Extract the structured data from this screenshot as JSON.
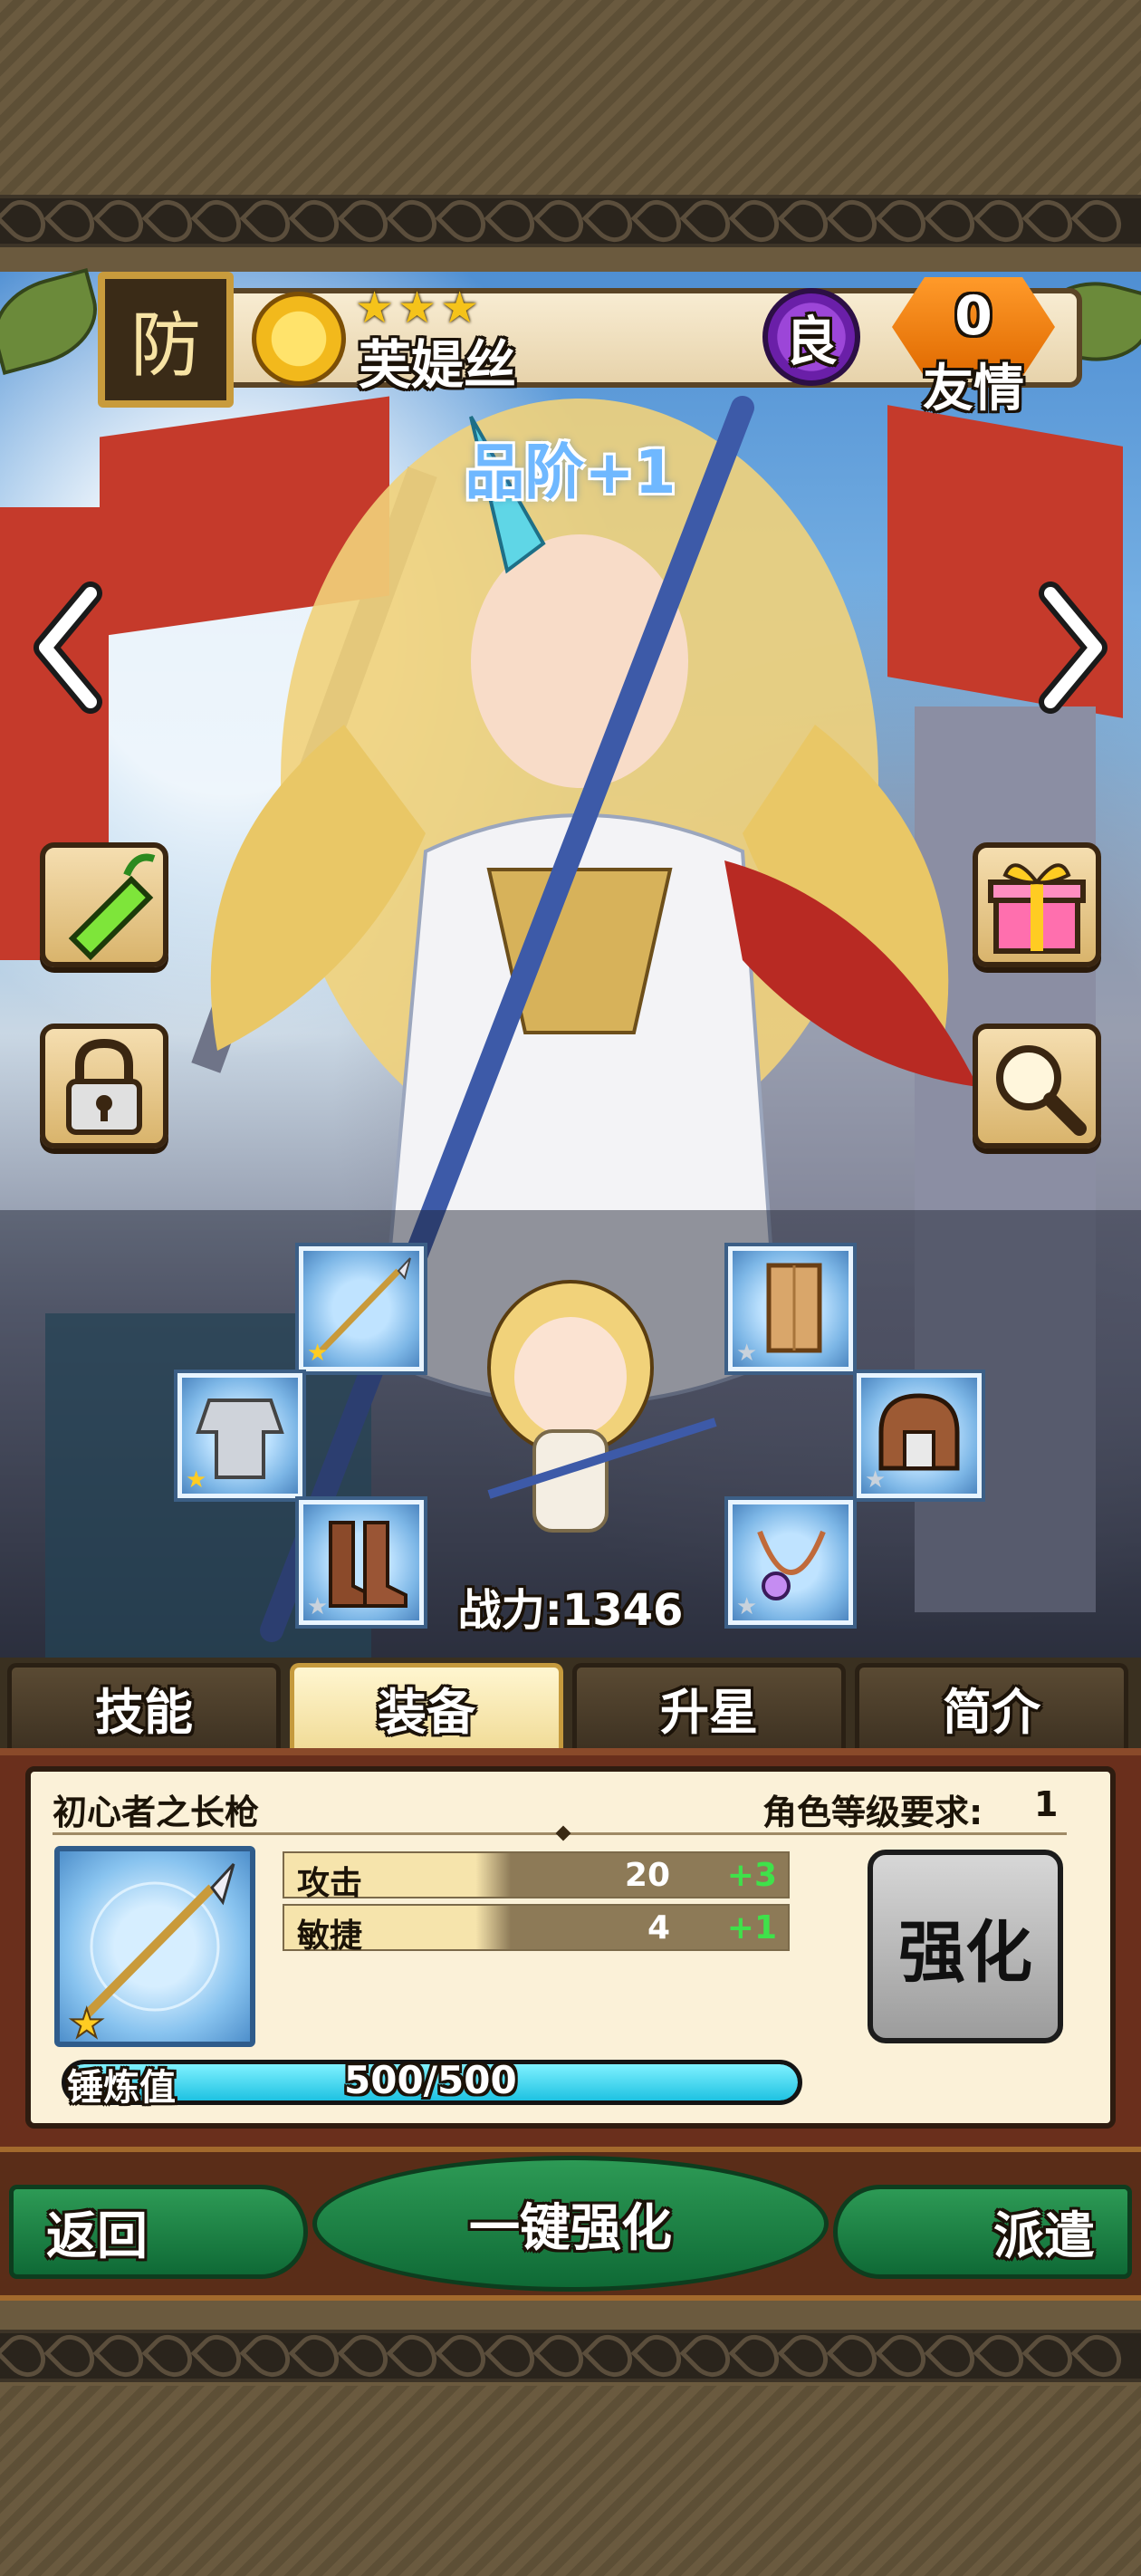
{
  "header": {
    "class_badge": "防",
    "stars": "★★★",
    "character_name": "芙媞丝",
    "grade": "良",
    "friendship_value": "0",
    "friendship_label": "友情"
  },
  "rank_text": "品阶+1",
  "battle_power": "战力:1346",
  "tabs": [
    {
      "label": "技能",
      "active": false
    },
    {
      "label": "装备",
      "active": true
    },
    {
      "label": "升星",
      "active": false
    },
    {
      "label": "简介",
      "active": false
    }
  ],
  "equipment": {
    "item_name": "初心者之长枪",
    "level_req_label": "角色等级要求:",
    "level_req_value": "1",
    "stats": [
      {
        "name": "攻击",
        "value": "20",
        "bonus": "+3"
      },
      {
        "name": "敏捷",
        "value": "4",
        "bonus": "+1"
      }
    ],
    "enhance_label": "强化",
    "forge_label": "锤炼值",
    "forge_value": "500/500",
    "forge_progress": 1.0
  },
  "bottom": {
    "back_label": "返回",
    "one_click_label": "一键强化",
    "dispatch_label": "派遣"
  },
  "colors": {
    "rank_text": "#6fb8ff",
    "stat_bonus": "#3fe14a",
    "forge_fill": "#1ec2e2",
    "active_tab": "#f1dc98"
  }
}
